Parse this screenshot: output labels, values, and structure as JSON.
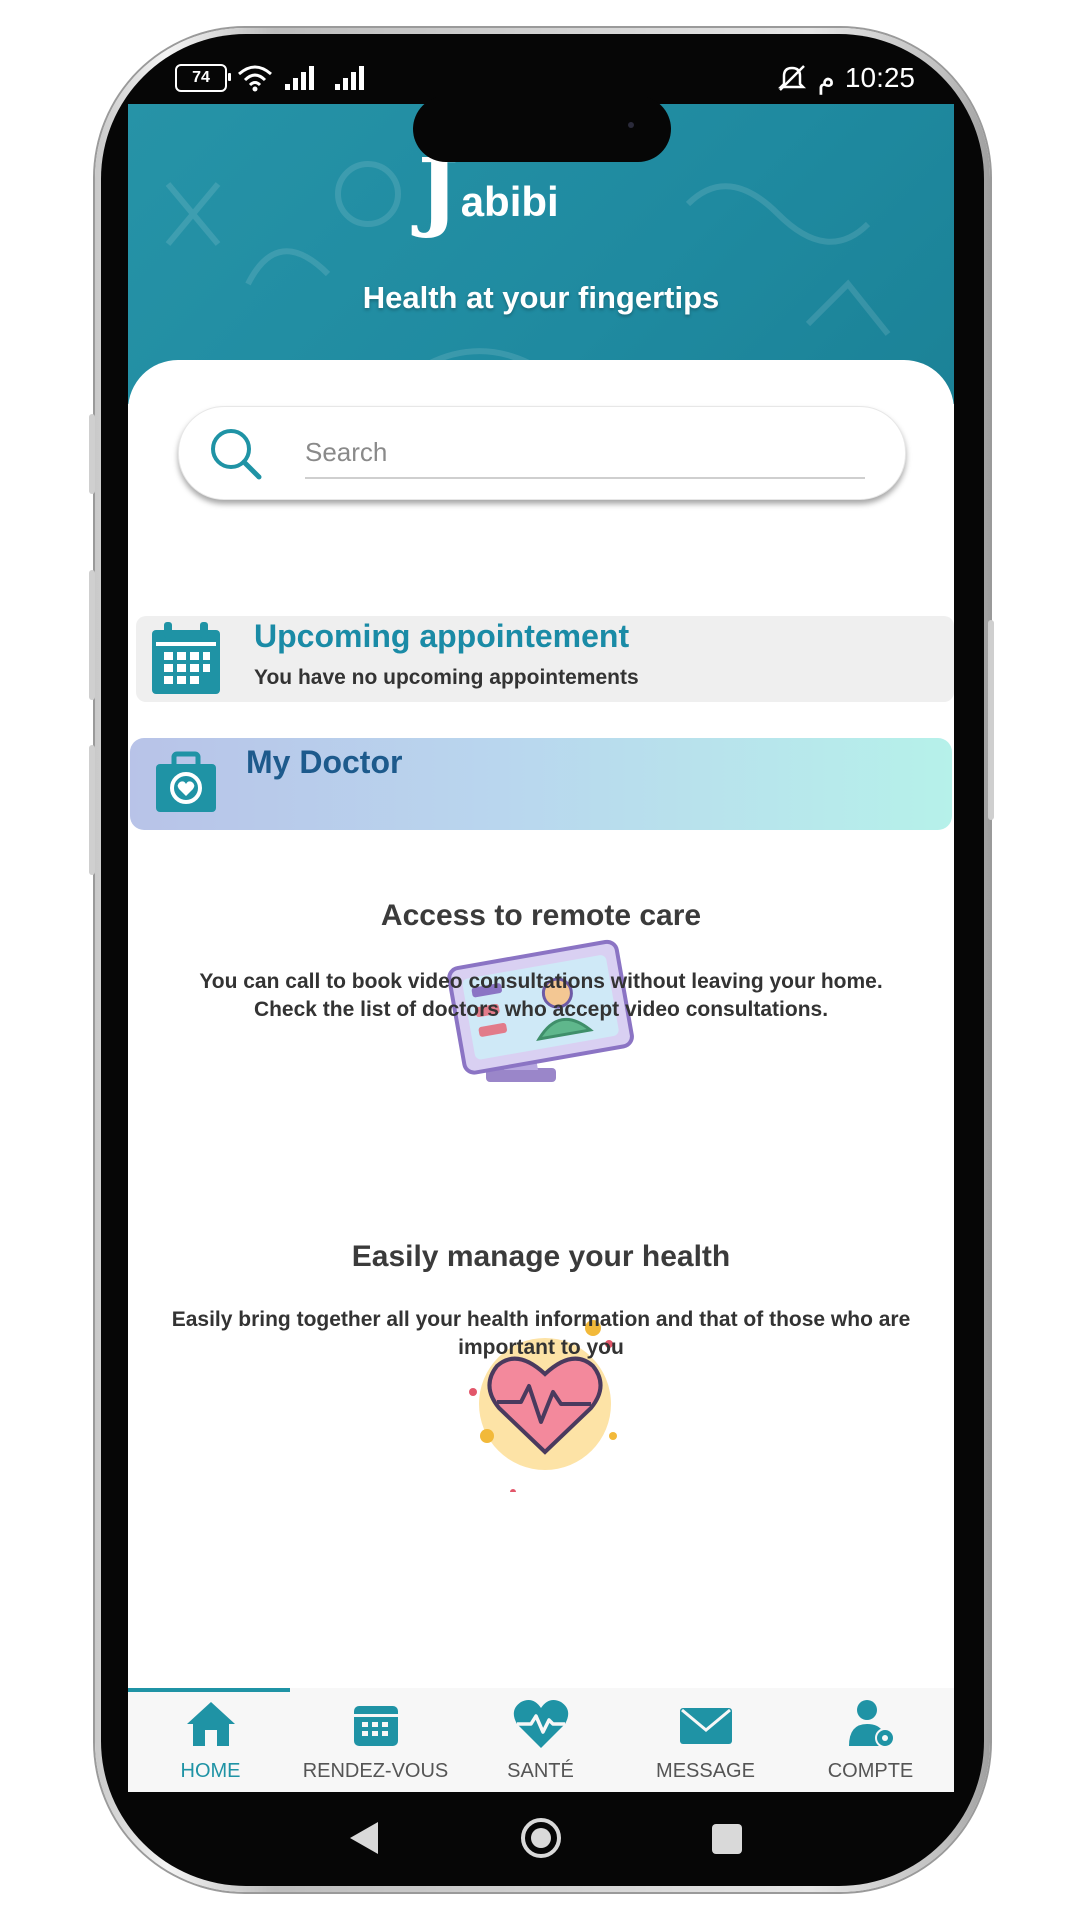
{
  "status_bar": {
    "battery": "74",
    "time": "10:25",
    "arabic_pm": "م"
  },
  "header": {
    "logo_letter": "J",
    "logo_text": "abibi",
    "tagline": "Health at your fingertips"
  },
  "search": {
    "placeholder": "Search"
  },
  "upcoming": {
    "title": "Upcoming appointement",
    "subtitle": "You have no upcoming appointements"
  },
  "doctor": {
    "title": "My Doctor"
  },
  "features": [
    {
      "title": "Access to remote care",
      "description": "You can call to book video consultations without leaving your home. Check the list of doctors who accept video consultations."
    },
    {
      "title": "Easily manage your health",
      "description": "Easily bring together all your health information and that of those who are important to you"
    }
  ],
  "bottom_nav": [
    {
      "label": "HOME",
      "icon": "home-icon",
      "active": true
    },
    {
      "label": "RENDEZ-VOUS",
      "icon": "calendar-icon",
      "active": false
    },
    {
      "label": "SANTÉ",
      "icon": "heartbeat-icon",
      "active": false
    },
    {
      "label": "MESSAGE",
      "icon": "envelope-icon",
      "active": false
    },
    {
      "label": "COMPTE",
      "icon": "user-settings-icon",
      "active": false
    }
  ],
  "colors": {
    "primary": "#1f93a5",
    "header_bg": "#2191a6",
    "doctor_title": "#1d5a8c"
  }
}
